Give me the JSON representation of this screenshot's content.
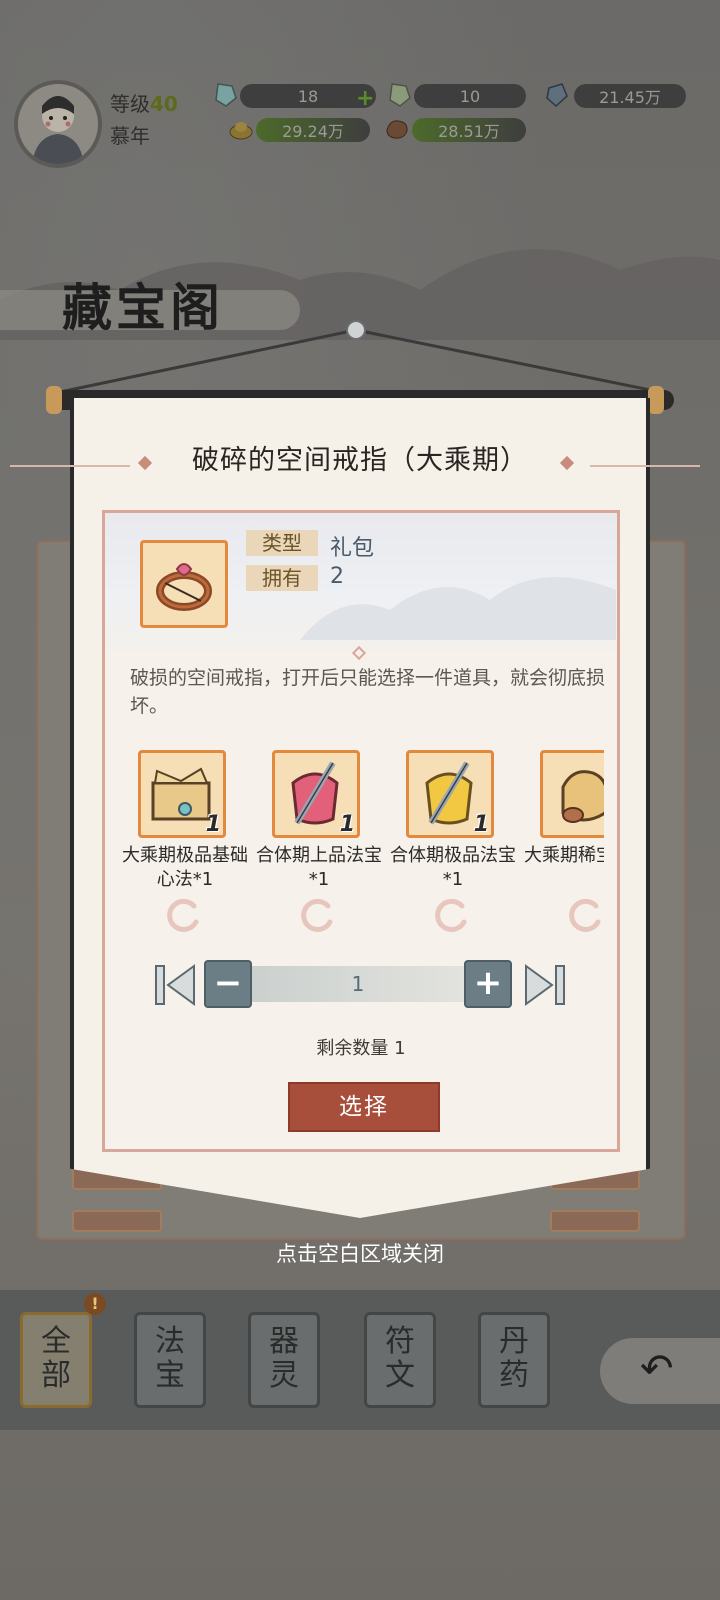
{
  "topbar": {
    "level_label": "等级",
    "level_value": "40",
    "player_name": "慕年",
    "resources": [
      {
        "icon": "blue-crystal-icon",
        "value": "18"
      },
      {
        "icon": "rainbow-crystal-icon",
        "value": "10"
      },
      {
        "icon": "spirit-stone-icon",
        "value": "21.45万"
      },
      {
        "icon": "gold-ingot-icon",
        "value": "29.24万"
      },
      {
        "icon": "ore-icon",
        "value": "28.51万"
      }
    ]
  },
  "page": {
    "title": "藏宝阁"
  },
  "popup": {
    "title": "破碎的空间戒指（大乘期）",
    "type_label": "类型",
    "type_value": "礼包",
    "owned_label": "拥有",
    "owned_value": "2",
    "description": "破损的空间戒指，打开后只能选择一件道具，就会彻底损坏。",
    "options": [
      {
        "name": "大乘期极品基础心法*1",
        "count": "1",
        "icon": "scroll-bundle-icon"
      },
      {
        "name": "合体期上品法宝*1",
        "count": "1",
        "icon": "dagger-bag-icon"
      },
      {
        "name": "合体期极品法宝*1",
        "count": "1",
        "icon": "golden-dagger-bag-icon"
      },
      {
        "name": "大乘期稀宝材料",
        "count": "",
        "icon": "material-sack-icon"
      }
    ],
    "stepper_value": "1",
    "remaining_label": "剩余数量 1",
    "select_label": "选择",
    "close_hint": "点击空白区域关闭"
  },
  "bottom_tabs": [
    {
      "label": "全部",
      "active": true
    },
    {
      "label": "法宝",
      "active": false
    },
    {
      "label": "器灵",
      "active": false
    },
    {
      "label": "符文",
      "active": false
    },
    {
      "label": "丹药",
      "active": false
    }
  ],
  "tab_notice": "!",
  "colors": {
    "accent_orange": "#e3893d",
    "select_button": "#a84f3b",
    "panel_border": "#d9a79a",
    "level_green": "#5d6a1b"
  }
}
